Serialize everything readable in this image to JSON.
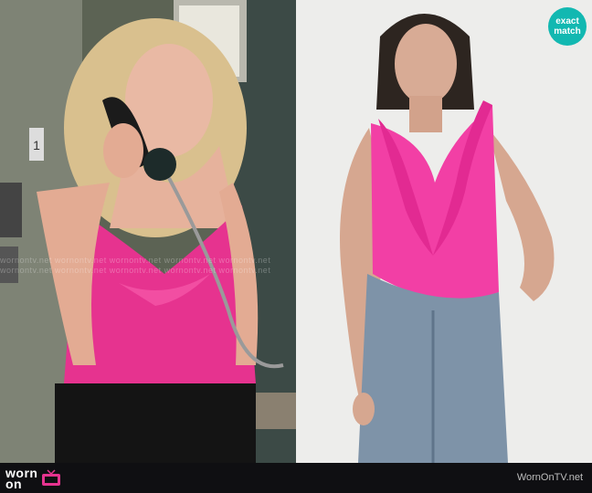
{
  "badge": {
    "line1": "exact",
    "line2": "match"
  },
  "watermark": {
    "text": "wornontv.net  wornontv.net  wornontv.net  wornontv.net  wornontv.net"
  },
  "footer": {
    "logo_top": "worn",
    "logo_bottom": "on",
    "url": "WornOnTV.net"
  },
  "colors": {
    "top_pink": "#e6338f",
    "badge": "#12b8b1",
    "footer": "#0f0f12"
  },
  "left_photo": {
    "sign_text": "1"
  }
}
